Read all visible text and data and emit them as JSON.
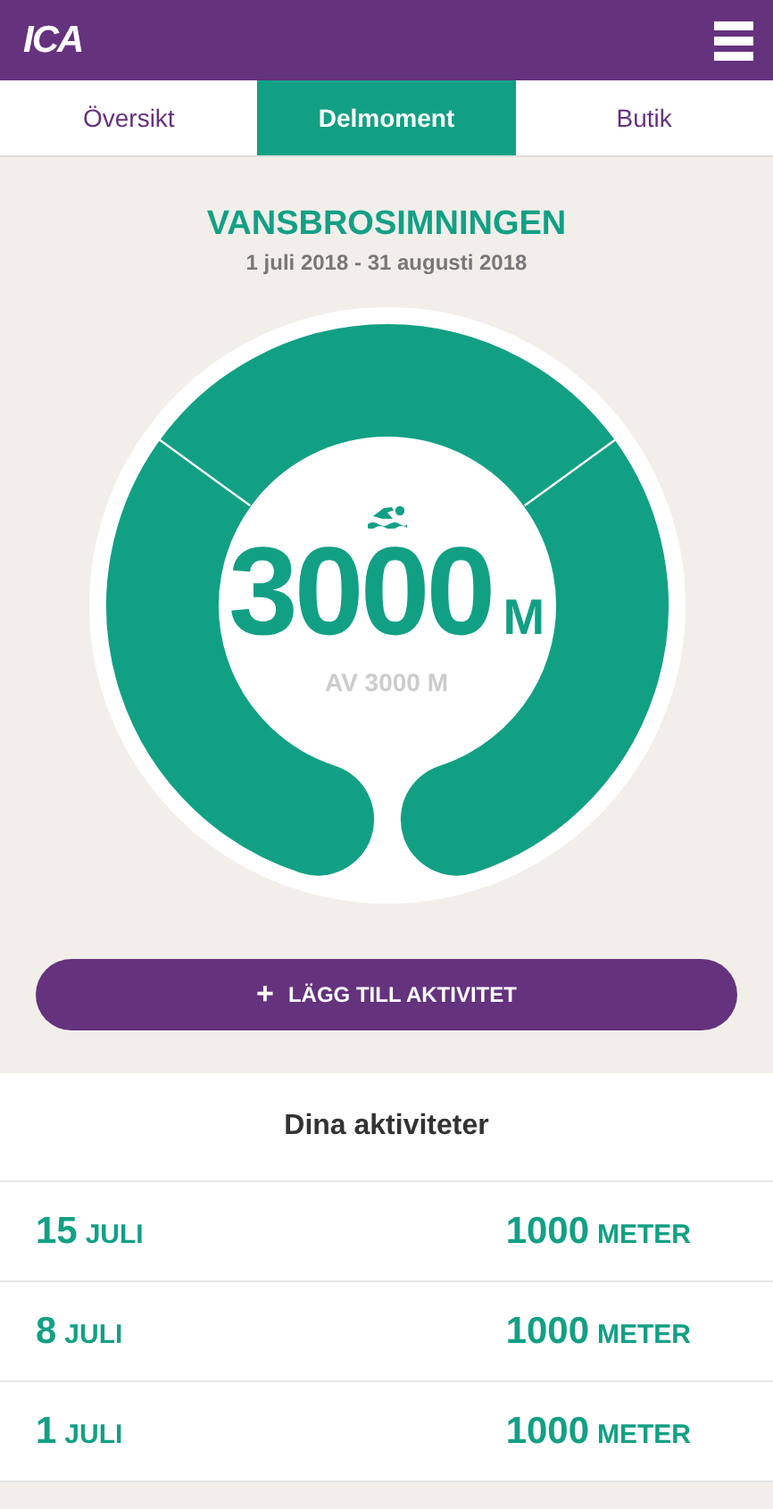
{
  "header": {
    "logo": "ICA"
  },
  "tabs": [
    {
      "label": "Översikt",
      "selected": false
    },
    {
      "label": "Delmoment",
      "selected": true
    },
    {
      "label": "Butik",
      "selected": false
    }
  ],
  "challenge": {
    "title": "VANSBROSIMNINGEN",
    "dates": "1 juli 2018 - 31 augusti 2018"
  },
  "gauge": {
    "value": "3000",
    "unit": "M",
    "target": "AV 3000 M"
  },
  "add_button": {
    "icon": "+",
    "label": "LÄGG TILL AKTIVITET"
  },
  "activities": {
    "heading": "Dina aktiviteter",
    "rows": [
      {
        "day": "15",
        "month": "JULI",
        "amount": "1000",
        "unit": "METER"
      },
      {
        "day": "8",
        "month": "JULI",
        "amount": "1000",
        "unit": "METER"
      },
      {
        "day": "1",
        "month": "JULI",
        "amount": "1000",
        "unit": "METER"
      }
    ]
  }
}
